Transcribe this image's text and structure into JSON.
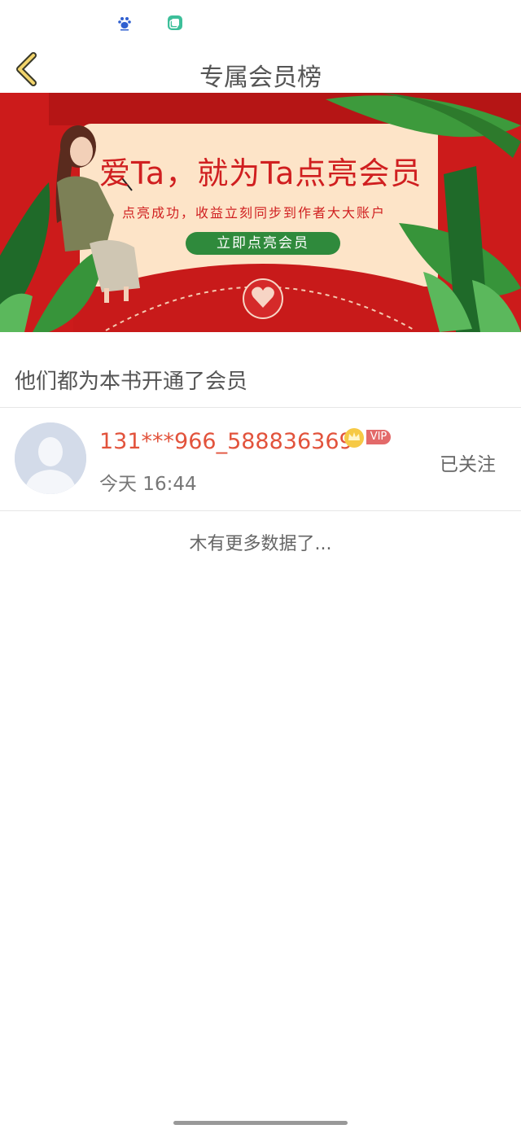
{
  "status_bar": {
    "icons": [
      "baidu-icon",
      "app-window-icon"
    ]
  },
  "header": {
    "title": "专属会员榜",
    "back_icon": "chevron-left-icon"
  },
  "banner": {
    "title": "爱Ta，就为Ta点亮会员",
    "subtitle": "点亮成功，收益立刻同步到作者大大账户",
    "cta_label": "立即点亮会员",
    "colors": {
      "background": "#cc1b1b",
      "card": "#fde4c8",
      "accent_green": "#2f8a3c"
    }
  },
  "section": {
    "title": "他们都为本书开通了会员"
  },
  "members": [
    {
      "username": "131***966_588836369",
      "vip_label": "VIP",
      "time": "今天 16:44",
      "follow_label": "已关注"
    }
  ],
  "footer": {
    "no_more_text": "木有更多数据了..."
  }
}
